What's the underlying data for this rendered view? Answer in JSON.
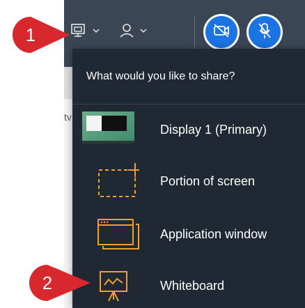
{
  "background": {
    "partial_text": "tv"
  },
  "toolbar": {
    "share_icon": "share-screen-icon",
    "people_icon": "people-icon",
    "camera_icon": "camera-off-icon",
    "mic_icon": "mic-off-icon"
  },
  "share_menu": {
    "title": "What would you like to share?",
    "items": [
      {
        "label": "Display 1 (Primary)",
        "icon": "display-thumbnail"
      },
      {
        "label": "Portion of screen",
        "icon": "portion-screen-icon"
      },
      {
        "label": "Application window",
        "icon": "app-window-icon"
      },
      {
        "label": "Whiteboard",
        "icon": "whiteboard-icon"
      }
    ]
  },
  "callouts": [
    {
      "number": "1"
    },
    {
      "number": "2"
    }
  ],
  "colors": {
    "accent": "#1a74e4",
    "icon_orange": "#f0a030",
    "menu_bg": "#1f2833",
    "callout_red": "#d9272e"
  }
}
